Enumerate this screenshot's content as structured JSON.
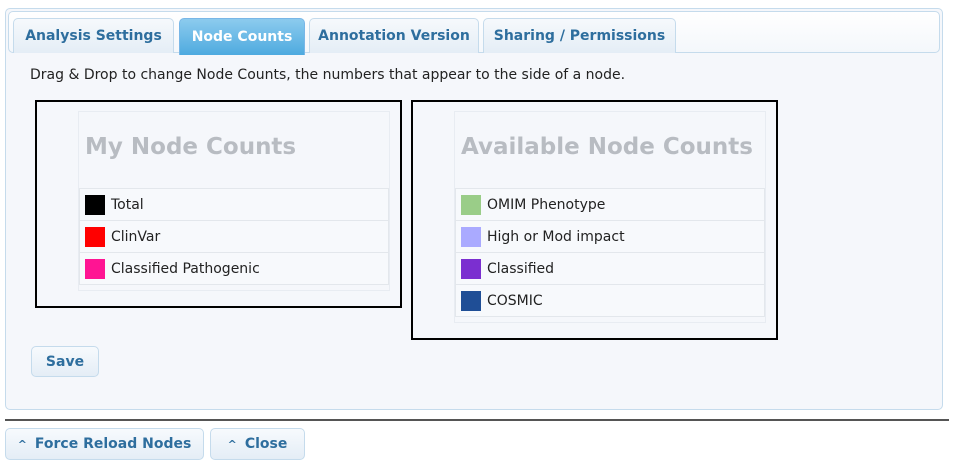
{
  "tabs": [
    {
      "label": "Analysis Settings",
      "active": false
    },
    {
      "label": "Node Counts",
      "active": true
    },
    {
      "label": "Annotation Version",
      "active": false
    },
    {
      "label": "Sharing / Permissions",
      "active": false
    }
  ],
  "instructions": "Drag & Drop to change Node Counts, the numbers that appear to the side of a node.",
  "my_node_counts": {
    "title": "My Node Counts",
    "items": [
      {
        "label": "Total",
        "color": "#000000"
      },
      {
        "label": "ClinVar",
        "color": "#ff0000"
      },
      {
        "label": "Classified Pathogenic",
        "color": "#ff1493"
      }
    ]
  },
  "available_node_counts": {
    "title": "Available Node Counts",
    "items": [
      {
        "label": "OMIM Phenotype",
        "color": "#9acd88"
      },
      {
        "label": "High or Mod impact",
        "color": "#aaaaff"
      },
      {
        "label": "Classified",
        "color": "#7b2fd0"
      },
      {
        "label": "COSMIC",
        "color": "#1f4e96"
      }
    ]
  },
  "save_label": "Save",
  "footer": {
    "force_reload_label": "Force Reload Nodes",
    "close_label": "Close",
    "caret_glyph": "^"
  }
}
